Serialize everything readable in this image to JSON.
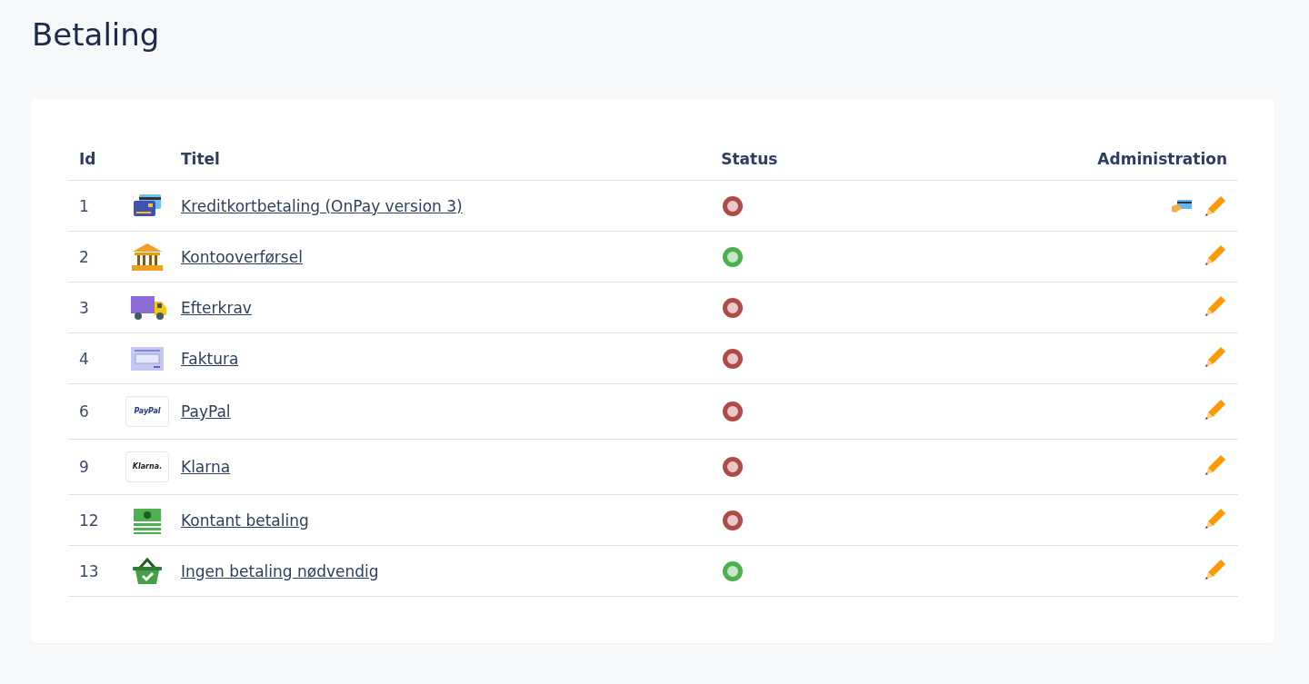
{
  "page": {
    "title": "Betaling"
  },
  "table": {
    "columns": [
      "Id",
      "Titel",
      "Status",
      "Administration"
    ],
    "rows": [
      {
        "id": "1",
        "kind": "card",
        "title": "Kreditkortbetaling (OnPay version 3)",
        "active": false,
        "card_settings": true
      },
      {
        "id": "2",
        "kind": "bank",
        "title": "Kontooverførsel",
        "active": true,
        "card_settings": false
      },
      {
        "id": "3",
        "kind": "truck",
        "title": "Efterkrav",
        "active": false,
        "card_settings": false
      },
      {
        "id": "4",
        "kind": "invoice",
        "title": "Faktura",
        "active": false,
        "card_settings": false
      },
      {
        "id": "6",
        "kind": "paypal",
        "logo_text": "PayPal",
        "title": "PayPal",
        "active": false,
        "card_settings": false
      },
      {
        "id": "9",
        "kind": "klarna",
        "logo_text": "Klarna.",
        "title": "Klarna",
        "active": false,
        "card_settings": false
      },
      {
        "id": "12",
        "kind": "cash",
        "title": "Kontant betaling",
        "active": false,
        "card_settings": false
      },
      {
        "id": "13",
        "kind": "basket",
        "title": "Ingen betaling nødvendig",
        "active": true,
        "card_settings": false
      }
    ]
  }
}
